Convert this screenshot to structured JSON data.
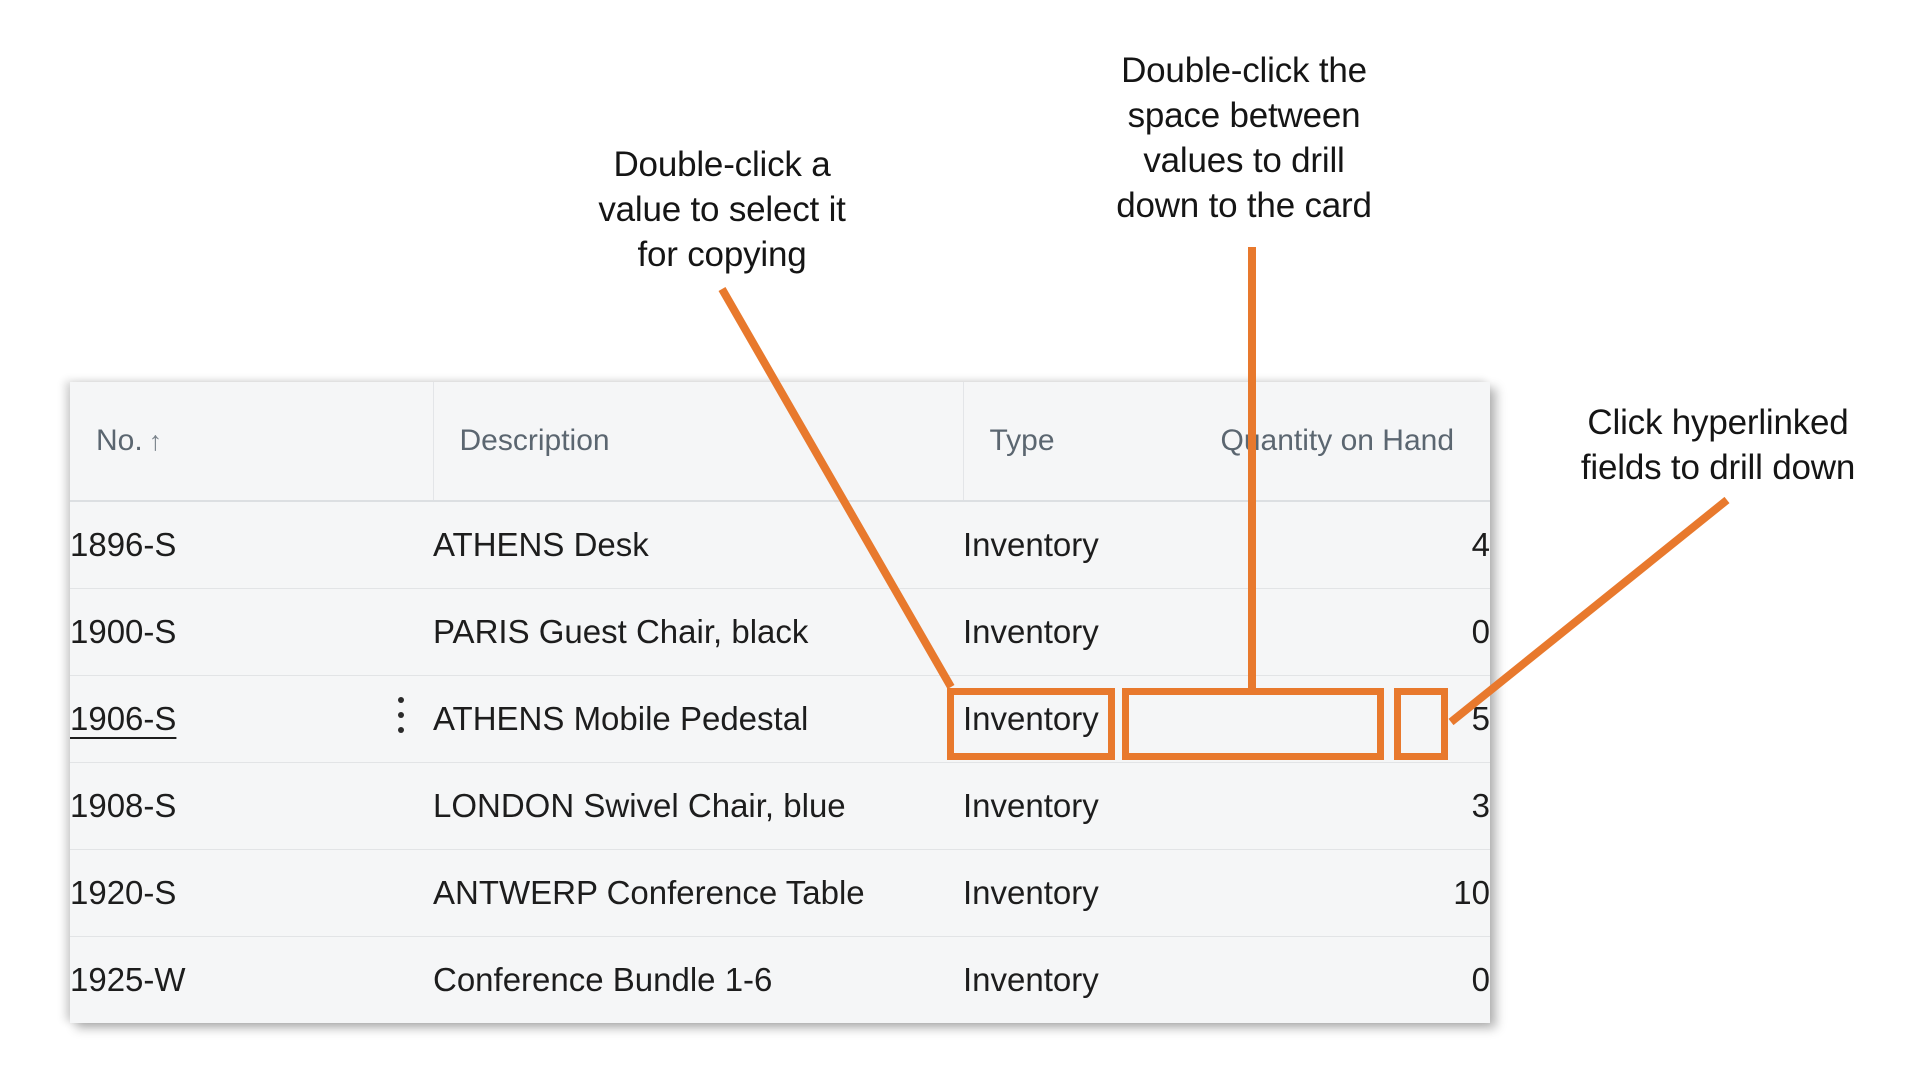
{
  "callouts": {
    "copy": "Double-click a\nvalue to select it\nfor copying",
    "drill_down_card": "Double-click the\nspace between\nvalues to drill\ndown to the card",
    "hyperlink": "Click hyperlinked\nfields to drill down"
  },
  "colors": {
    "annotation_orange": "#e8792d",
    "selection_cyan": "#b4e4e2",
    "hyperlink_teal": "#0f7a80",
    "header_text": "#5b6670",
    "grid_background": "#f5f6f7"
  },
  "grid": {
    "columns": [
      {
        "key": "no",
        "label": "No.",
        "sort_indicator": "↑",
        "align": "left"
      },
      {
        "key": "desc",
        "label": "Description",
        "align": "left"
      },
      {
        "key": "type",
        "label": "Type",
        "align": "left"
      },
      {
        "key": "qty",
        "label": "Quantity on Hand",
        "align": "right"
      }
    ],
    "rows": [
      {
        "no": "1896-S",
        "desc": "ATHENS Desk",
        "type": "Inventory",
        "qty": "4",
        "selected": false
      },
      {
        "no": "1900-S",
        "desc": "PARIS Guest Chair, black",
        "type": "Inventory",
        "qty": "0",
        "selected": false
      },
      {
        "no": "1906-S",
        "desc": "ATHENS Mobile Pedestal",
        "type": "Inventory",
        "qty": "5",
        "selected": true
      },
      {
        "no": "1908-S",
        "desc": "LONDON Swivel Chair, blue",
        "type": "Inventory",
        "qty": "3",
        "selected": false
      },
      {
        "no": "1920-S",
        "desc": "ANTWERP Conference Table",
        "type": "Inventory",
        "qty": "10",
        "selected": false
      },
      {
        "no": "1925-W",
        "desc": "Conference Bundle 1-6",
        "type": "Inventory",
        "qty": "0",
        "selected": false
      }
    ]
  },
  "highlights": [
    {
      "name": "type-value-highlight",
      "target": "Inventory"
    },
    {
      "name": "empty-space-highlight",
      "target": ""
    },
    {
      "name": "quantity-value-highlight",
      "target": "5"
    }
  ]
}
